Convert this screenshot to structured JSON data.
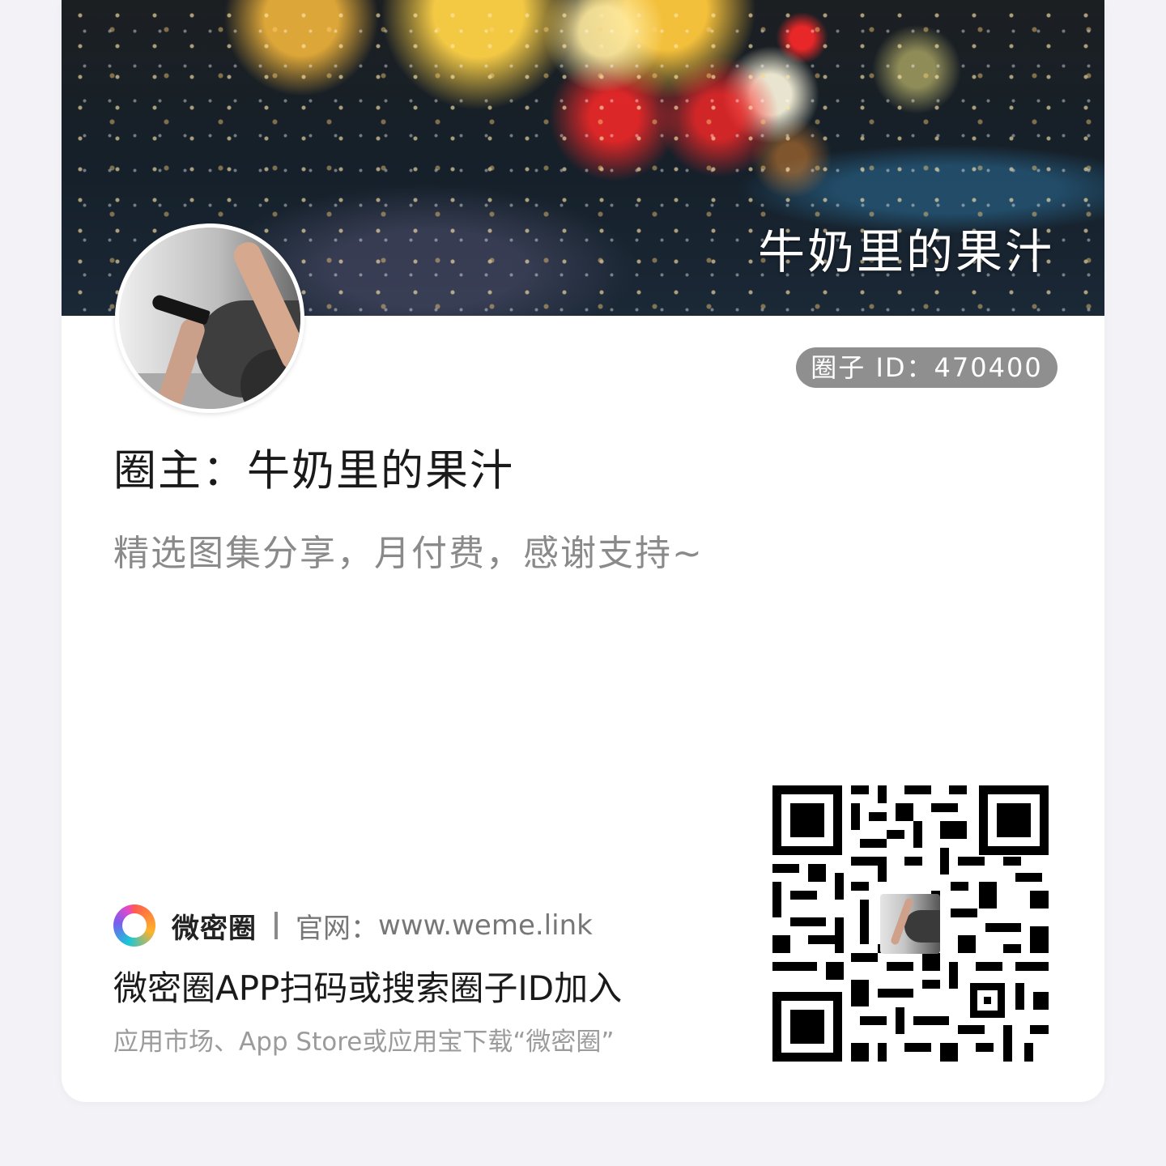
{
  "cover": {
    "title": "牛奶里的果汁"
  },
  "badge": {
    "label": "圈子 ID：470400"
  },
  "owner": {
    "text": "圈主：牛奶里的果汁"
  },
  "description": "精选图集分享，月付费，感谢支持~",
  "footer": {
    "brand_name": "微密圈",
    "website_label": "官网：",
    "website_url": "www.weme.link",
    "join_instruction": "微密圈APP扫码或搜索圈子ID加入",
    "download_hint": "应用市场、App Store或应用宝下载“微密圈”"
  },
  "icons": {
    "brand_logo": "brand-ring-icon",
    "qr": "qr-code-icon"
  },
  "colors": {
    "badge_bg": "#8f8f8f",
    "text_primary": "#1a1a1a",
    "text_secondary": "#8a8a8a"
  }
}
